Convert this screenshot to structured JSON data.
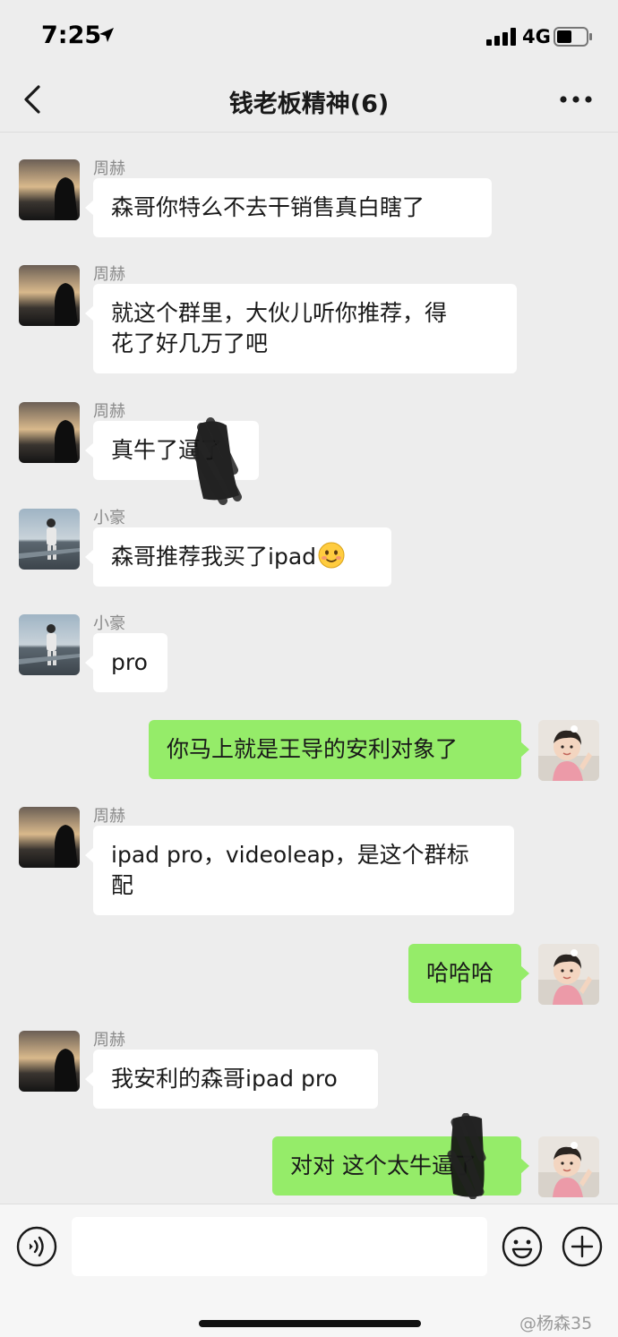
{
  "status_bar": {
    "time": "7:25",
    "network": "4G",
    "icons": [
      "location-arrow-icon",
      "signal-icon",
      "battery-icon"
    ]
  },
  "nav": {
    "title": "钱老板精神(6)",
    "icons": [
      "back-chevron-icon",
      "more-dots-icon"
    ]
  },
  "messages": [
    {
      "side": "in",
      "sender": "周赫",
      "lines": [
        "森哥你特么不去干销售真白瞎了"
      ]
    },
    {
      "side": "in",
      "sender": "周赫",
      "lines": [
        "就这个群里，大伙儿听你推荐，得",
        "花了好几万了吧"
      ]
    },
    {
      "side": "in",
      "sender": "周赫",
      "lines": [
        "真牛了逼了"
      ]
    },
    {
      "side": "in",
      "sender": "小豪",
      "lines": [
        "森哥推荐我买了ipad"
      ],
      "emoji": "smile-blush-emoji"
    },
    {
      "side": "in",
      "sender": "小豪",
      "lines": [
        "pro"
      ]
    },
    {
      "side": "out",
      "lines": [
        "你马上就是王导的安利对象了"
      ]
    },
    {
      "side": "in",
      "sender": "周赫",
      "lines": [
        "ipad pro，videoleap，是这个群标",
        "配"
      ]
    },
    {
      "side": "out",
      "lines": [
        "哈哈哈"
      ]
    },
    {
      "side": "in",
      "sender": "周赫",
      "lines": [
        "我安利的森哥ipad pro"
      ]
    },
    {
      "side": "out",
      "lines": [
        "对对 这个太牛逼了"
      ]
    }
  ],
  "input_bar": {
    "placeholder": "",
    "icons": [
      "voice-icon",
      "emoji-icon",
      "add-icon"
    ]
  },
  "watermark": "@杨森35",
  "colors": {
    "background": "#ededed",
    "incoming_bubble": "#ffffff",
    "outgoing_bubble": "#95ec69",
    "sender_name": "#8a8a8a"
  }
}
